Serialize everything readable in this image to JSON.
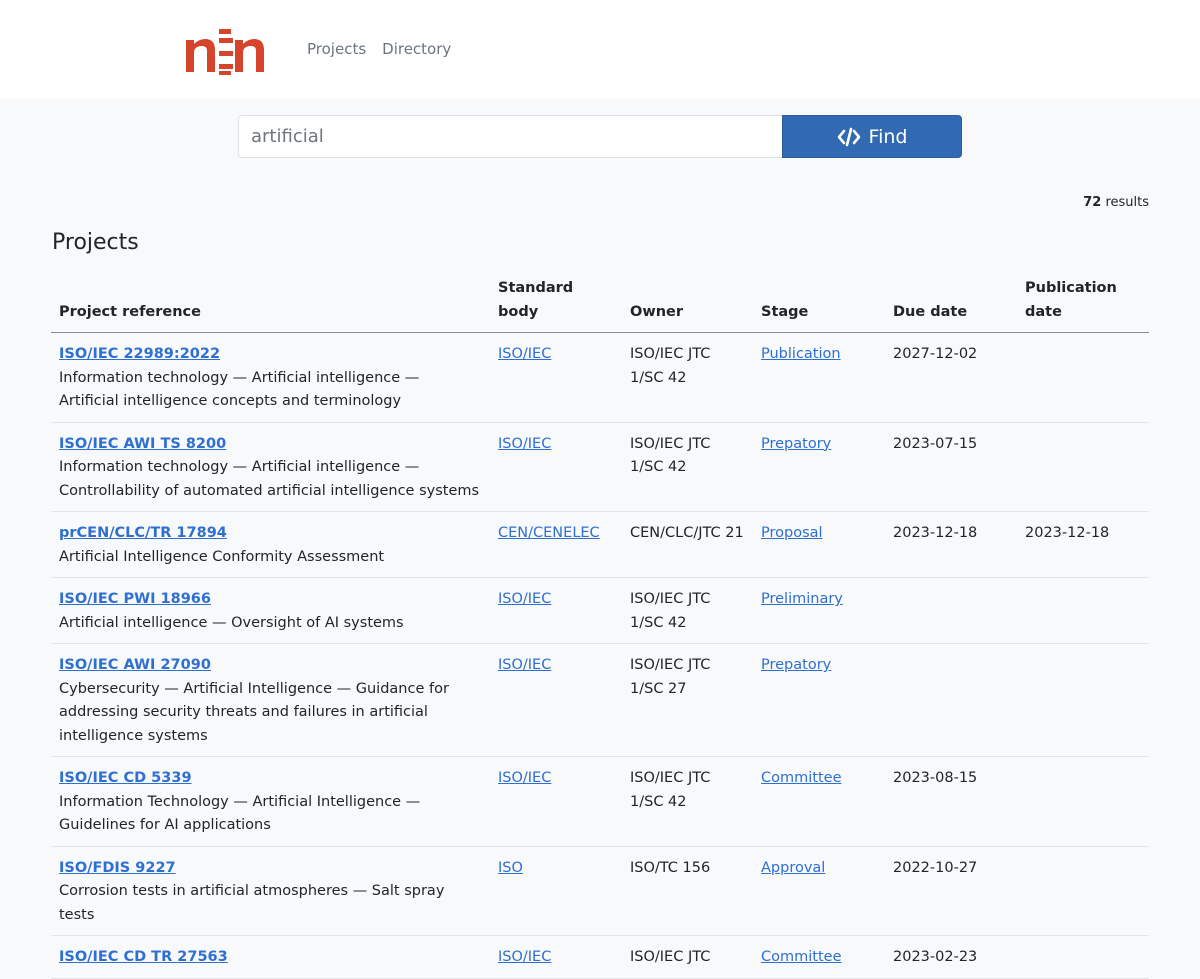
{
  "header": {
    "logo_text": "nen",
    "nav": [
      {
        "label": "Projects"
      },
      {
        "label": "Directory"
      }
    ]
  },
  "search": {
    "value": "artificial",
    "button_label": "Find"
  },
  "results": {
    "count": "72",
    "suffix": "results"
  },
  "section_title": "Projects",
  "table": {
    "columns": [
      "Project reference",
      "Standard body",
      "Owner",
      "Stage",
      "Due date",
      "Publication date"
    ],
    "rows": [
      {
        "ref": "ISO/IEC 22989:2022",
        "desc": "Information technology — Artificial intelligence — Artificial intelligence concepts and terminology",
        "body": "ISO/IEC",
        "owner": "ISO/IEC JTC 1/SC 42",
        "stage": "Publication",
        "due": "2027-12-02",
        "pub": ""
      },
      {
        "ref": "ISO/IEC AWI TS 8200",
        "desc": "Information technology — Artificial intelligence — Controllability of automated artificial intelligence systems",
        "body": "ISO/IEC",
        "owner": "ISO/IEC JTC 1/SC 42",
        "stage": "Prepatory",
        "due": "2023-07-15",
        "pub": ""
      },
      {
        "ref": "prCEN/CLC/TR 17894",
        "desc": "Artificial Intelligence Conformity Assessment",
        "body": "CEN/CENELEC",
        "owner": "CEN/CLC/JTC 21",
        "stage": "Proposal",
        "due": "2023-12-18",
        "pub": "2023-12-18"
      },
      {
        "ref": "ISO/IEC PWI 18966",
        "desc": "Artificial intelligence — Oversight of AI systems",
        "body": "ISO/IEC",
        "owner": "ISO/IEC JTC 1/SC 42",
        "stage": "Preliminary",
        "due": "",
        "pub": ""
      },
      {
        "ref": "ISO/IEC AWI 27090",
        "desc": "Cybersecurity — Artificial Intelligence — Guidance for addressing security threats and failures in artificial intelligence systems",
        "body": "ISO/IEC",
        "owner": "ISO/IEC JTC 1/SC 27",
        "stage": "Prepatory",
        "due": "",
        "pub": ""
      },
      {
        "ref": "ISO/IEC CD 5339",
        "desc": "Information Technology — Artificial Intelligence — Guidelines for AI applications",
        "body": "ISO/IEC",
        "owner": "ISO/IEC JTC 1/SC 42",
        "stage": "Committee",
        "due": "2023-08-15",
        "pub": ""
      },
      {
        "ref": "ISO/FDIS 9227",
        "desc": "Corrosion tests in artificial atmospheres — Salt spray tests",
        "body": "ISO",
        "owner": "ISO/TC 156",
        "stage": "Approval",
        "due": "2022-10-27",
        "pub": ""
      },
      {
        "ref": "ISO/IEC CD TR 27563",
        "desc": "",
        "body": "ISO/IEC",
        "owner": "ISO/IEC JTC",
        "stage": "Committee",
        "due": "2023-02-23",
        "pub": ""
      }
    ]
  },
  "colors": {
    "primary": "#3169b3",
    "link": "#2e6fd1",
    "logo": "#d4452b",
    "background": "#f8f9fa"
  }
}
